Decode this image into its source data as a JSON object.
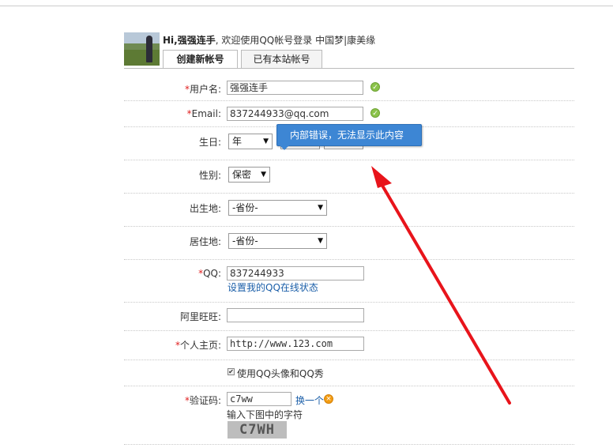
{
  "header": {
    "greeting_prefix": "Hi,",
    "username": "强强连手",
    "greeting_suffix": ", 欢迎使用QQ帐号登录 中国梦|康美缘"
  },
  "tabs": [
    {
      "label": "创建新帐号",
      "active": true
    },
    {
      "label": "已有本站帐号",
      "active": false
    }
  ],
  "form": {
    "username": {
      "required": "*",
      "label": "用户名:",
      "value": "强强连手"
    },
    "email": {
      "required": "*",
      "label": "Email:",
      "value": "837244933@qq.com"
    },
    "birthday": {
      "label": "生日:",
      "year": "年"
    },
    "gender": {
      "label": "性别:",
      "value": "保密"
    },
    "birthplace": {
      "label": "出生地:",
      "value": "-省份-"
    },
    "residence": {
      "label": "居住地:",
      "value": "-省份-"
    },
    "qq": {
      "required": "*",
      "label": "QQ:",
      "value": "837244933",
      "link": "设置我的QQ在线状态"
    },
    "aliwangwang": {
      "label": "阿里旺旺:",
      "value": ""
    },
    "homepage": {
      "required": "*",
      "label": "个人主页:",
      "value": "http://www.123.com"
    },
    "use_qq_avatar": {
      "label": "使用QQ头像和QQ秀",
      "checked": true
    },
    "captcha": {
      "required": "*",
      "label": "验证码:",
      "value": "c7ww",
      "refresh_label": "换一个",
      "hint": "输入下图中的字符",
      "image_text": "C7WH"
    }
  },
  "tooltip": {
    "text": "内部错误，无法显示此内容"
  },
  "colors": {
    "required": "#e02020",
    "tooltip": "#3d86d4",
    "link": "#1a5ea8",
    "ok": "#8bc34a",
    "arrow": "#e8141b"
  },
  "icons": {
    "ok": "check-circle-icon",
    "refresh": "refresh-icon"
  }
}
